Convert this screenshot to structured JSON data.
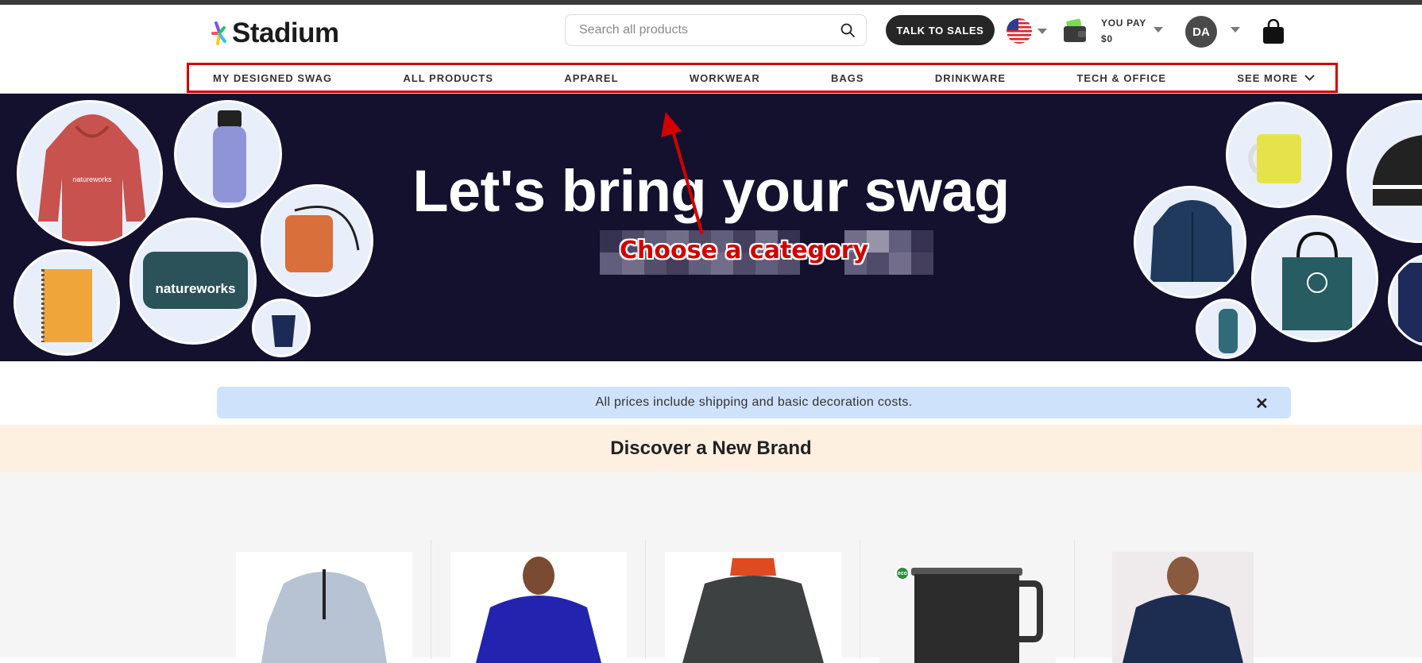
{
  "header": {
    "logo_text": "Stadium",
    "search_placeholder": "Search all products",
    "talk_to_sales": "TALK TO SALES",
    "you_pay_label": "YOU PAY",
    "you_pay_amount": "$0",
    "avatar_initials": "DA"
  },
  "nav": {
    "items": [
      {
        "label": "MY DESIGNED SWAG"
      },
      {
        "label": "ALL PRODUCTS"
      },
      {
        "label": "APPAREL"
      },
      {
        "label": "WORKWEAR"
      },
      {
        "label": "BAGS"
      },
      {
        "label": "DRINKWARE"
      },
      {
        "label": "TECH & OFFICE"
      },
      {
        "label": "SEE MORE"
      }
    ]
  },
  "hero": {
    "title": "Let's bring your swag"
  },
  "annotation": {
    "text": "Choose a category"
  },
  "info": {
    "message": "All prices include shipping and basic decoration costs.",
    "close_glyph": "✕"
  },
  "brand": {
    "heading": "Discover a New Brand"
  },
  "products": {
    "eco_badge": "eco"
  },
  "colors": {
    "hero_bg": "#14112e",
    "annotation_red": "#d40000",
    "info_bg": "#cfe2fb",
    "brand_band": "#fdf0e1"
  }
}
